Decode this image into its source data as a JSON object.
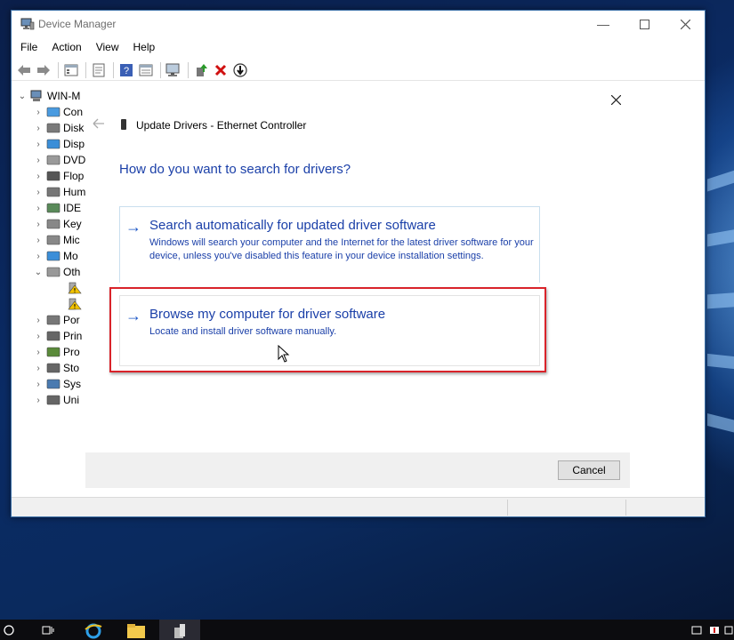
{
  "window": {
    "title": "Device Manager"
  },
  "menu": [
    "File",
    "Action",
    "View",
    "Help"
  ],
  "toolbar": {
    "buttons": [
      "back-icon",
      "forward-icon",
      "tree-view-icon",
      "properties-icon",
      "help-icon",
      "details-icon",
      "scan-hardware-icon",
      "update-driver-icon",
      "uninstall-icon",
      "disable-icon"
    ]
  },
  "tree": {
    "root": "WIN-M",
    "items": [
      {
        "label": "Con",
        "icon": "computer-icon",
        "color": "#4a9be0"
      },
      {
        "label": "Disk",
        "icon": "disk-icon",
        "color": "#7a7a7a"
      },
      {
        "label": "Disp",
        "icon": "display-icon",
        "color": "#3b8ed8"
      },
      {
        "label": "DVD",
        "icon": "dvd-icon",
        "color": "#9a9a9a"
      },
      {
        "label": "Flop",
        "icon": "floppy-icon",
        "color": "#555555"
      },
      {
        "label": "Hum",
        "icon": "hid-icon",
        "color": "#777777"
      },
      {
        "label": "IDE",
        "icon": "ide-icon",
        "color": "#5a8a5a"
      },
      {
        "label": "Key",
        "icon": "keyboard-icon",
        "color": "#888888"
      },
      {
        "label": "Mic",
        "icon": "mouse-icon",
        "color": "#888888"
      },
      {
        "label": "Mo",
        "icon": "monitor-icon",
        "color": "#3b8ed8"
      },
      {
        "label": "Oth",
        "icon": "other-devices-icon",
        "color": "#999999"
      },
      {
        "label": "",
        "icon": "warning-device-icon",
        "color": "#e8b300"
      },
      {
        "label": "",
        "icon": "warning-device-icon",
        "color": "#e8b300"
      },
      {
        "label": "Por",
        "icon": "ports-icon",
        "color": "#777777"
      },
      {
        "label": "Prin",
        "icon": "printer-icon",
        "color": "#666666"
      },
      {
        "label": "Pro",
        "icon": "processor-icon",
        "color": "#5a8a3a"
      },
      {
        "label": "Sto",
        "icon": "storage-icon",
        "color": "#666666"
      },
      {
        "label": "Sys",
        "icon": "system-icon",
        "color": "#4a7ab0"
      },
      {
        "label": "Uni",
        "icon": "usb-icon",
        "color": "#666666"
      }
    ]
  },
  "dialog": {
    "title": "Update Drivers - Ethernet Controller",
    "question": "How do you want to search for drivers?",
    "option1": {
      "title": "Search automatically for updated driver software",
      "desc": "Windows will search your computer and the Internet for the latest driver software for your device, unless you've disabled this feature in your device installation settings."
    },
    "option2": {
      "title": "Browse my computer for driver software",
      "desc": "Locate and install driver software manually."
    },
    "cancel": "Cancel"
  },
  "colors": {
    "link_blue": "#1a3fa8",
    "highlight_red": "#d9232a"
  }
}
